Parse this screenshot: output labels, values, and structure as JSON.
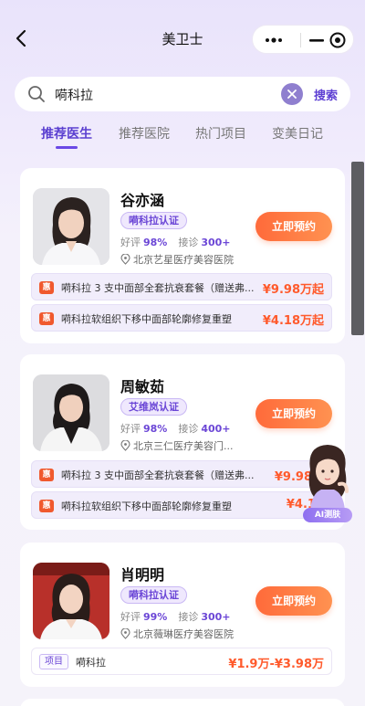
{
  "header": {
    "title": "美卫士"
  },
  "search": {
    "query": "嗬科拉",
    "button_label": "搜索"
  },
  "tabs": [
    {
      "label": "推荐医生",
      "active": true
    },
    {
      "label": "推荐医院",
      "active": false
    },
    {
      "label": "热门项目",
      "active": false
    },
    {
      "label": "变美日记",
      "active": false
    }
  ],
  "doctors": [
    {
      "name": "谷亦涵",
      "cert": "嗬科拉认证",
      "rating_label": "好评",
      "rating": "98%",
      "consult_label": "接诊",
      "consults": "300+",
      "hospital": "北京艺星医疗美容医院",
      "book_label": "立即预约",
      "packages": [
        {
          "tag": "惠",
          "text": "嗬科拉 3 支中面部全套抗衰套餐（赠送弗...",
          "price": "¥9.98万起"
        },
        {
          "tag": "惠",
          "text": "嗬科拉软组织下移中面部轮廓修复重塑",
          "price": "¥4.18万起"
        }
      ]
    },
    {
      "name": "周敏茹",
      "cert": "艾维岚认证",
      "rating_label": "好评",
      "rating": "98%",
      "consult_label": "接诊",
      "consults": "400+",
      "hospital": "北京三仁医疗美容门...",
      "book_label": "立即预约",
      "packages": [
        {
          "tag": "惠",
          "text": "嗬科拉 3 支中面部全套抗衰套餐（赠送弗...",
          "price": "¥9.98万"
        },
        {
          "tag": "惠",
          "text": "嗬科拉软组织下移中面部轮廓修复重塑",
          "price": "¥4.18"
        }
      ]
    },
    {
      "name": "肖明明",
      "cert": "嗬科拉认证",
      "rating_label": "好评",
      "rating": "99%",
      "consult_label": "接诊",
      "consults": "300+",
      "hospital": "北京薇琳医疗美容医院",
      "book_label": "立即预约",
      "project": {
        "tag": "项目",
        "text": "嗬科拉",
        "price": "¥1.9万-¥3.98万"
      }
    }
  ],
  "ai_assistant": {
    "label": "AI测肤"
  },
  "colors": {
    "accent": "#5a3fd0",
    "book_button": "#ff7a45",
    "price": "#ff5a2c"
  }
}
